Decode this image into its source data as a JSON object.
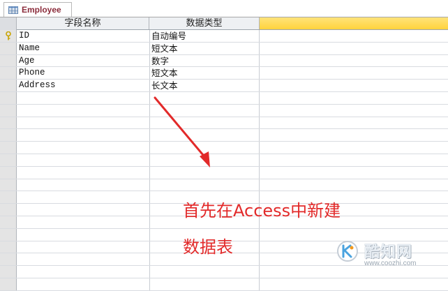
{
  "tab": {
    "title": "Employee",
    "icon": "table-icon"
  },
  "columns": [
    "字段名称",
    "数据类型",
    ""
  ],
  "rows": [
    {
      "field": "ID",
      "type": "自动编号",
      "primary_key": true
    },
    {
      "field": "Name",
      "type": "短文本",
      "primary_key": false
    },
    {
      "field": "Age",
      "type": "数字",
      "primary_key": false
    },
    {
      "field": "Phone",
      "type": "短文本",
      "primary_key": false
    },
    {
      "field": "Address",
      "type": "长文本",
      "primary_key": false
    }
  ],
  "annotation": {
    "line1": "首先在Access中新建",
    "line2": "数据表"
  },
  "watermark": {
    "brand": "酷知网",
    "url": "www.coozhi.com"
  },
  "colors": {
    "tab_text": "#8b2c3b",
    "highlight_header": "#ffd33c",
    "annotation": "#e22a2a"
  }
}
